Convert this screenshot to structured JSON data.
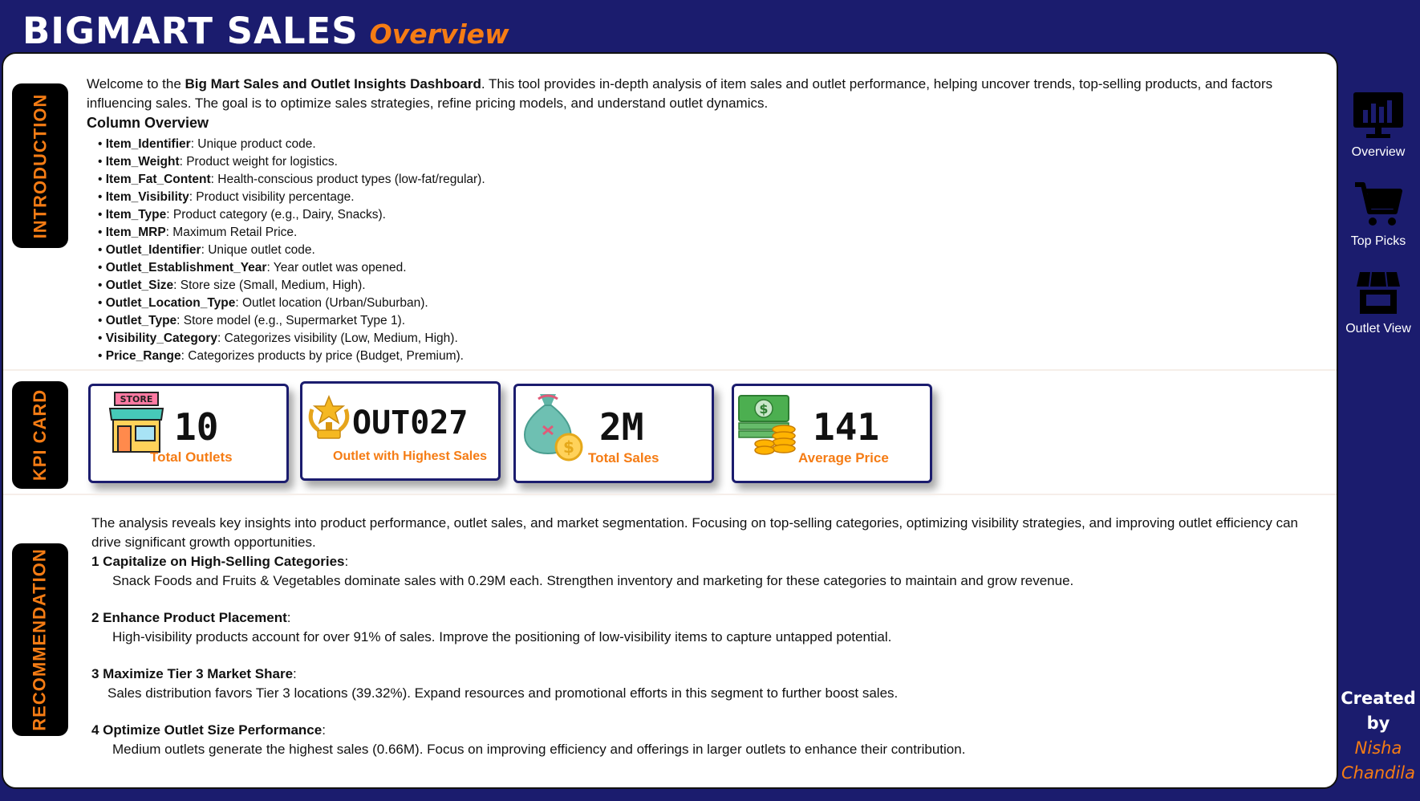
{
  "header": {
    "title": "BIGMART SALES",
    "subtitle": "Overview"
  },
  "sections": {
    "intro_tag": "INTRODUCTION",
    "kpi_tag": "KPI CARD",
    "rec_tag": "RECOMMENDATION"
  },
  "intro": {
    "welcome_pre": "Welcome to the ",
    "welcome_bold": "Big Mart Sales and Outlet Insights Dashboard",
    "welcome_post": ". This tool provides in-depth analysis of item sales and outlet performance, helping uncover trends, top-selling products, and factors influencing sales. The goal is to optimize sales strategies, refine pricing models, and understand outlet dynamics.",
    "column_heading": "Column Overview",
    "columns": [
      {
        "name": "Item_Identifier",
        "desc": ": Unique product code."
      },
      {
        "name": "Item_Weight",
        "desc": ": Product weight for logistics."
      },
      {
        "name": "Item_Fat_Content",
        "desc": ": Health-conscious product types (low-fat/regular)."
      },
      {
        "name": "Item_Visibility",
        "desc": ": Product visibility percentage."
      },
      {
        "name": "Item_Type",
        "desc": ": Product category (e.g., Dairy, Snacks)."
      },
      {
        "name": "Item_MRP",
        "desc": ": Maximum Retail Price."
      },
      {
        "name": "Outlet_Identifier",
        "desc": ": Unique outlet code."
      },
      {
        "name": "Outlet_Establishment_Year",
        "desc": ": Year outlet was opened."
      },
      {
        "name": "Outlet_Size",
        "desc": ": Store size (Small, Medium, High)."
      },
      {
        "name": "Outlet_Location_Type",
        "desc": ": Outlet location (Urban/Suburban)."
      },
      {
        "name": "Outlet_Type",
        "desc": ": Store model (e.g., Supermarket Type 1)."
      },
      {
        "name": "Visibility_Category",
        "desc": ": Categorizes visibility (Low, Medium, High)."
      },
      {
        "name": "Price_Range",
        "desc": ": Categorizes products by price (Budget, Premium)."
      }
    ]
  },
  "kpis": [
    {
      "value": "10",
      "label": "Total Outlets",
      "icon": "store-icon"
    },
    {
      "value": "OUT027",
      "label": "Outlet with Highest Sales",
      "icon": "trophy-icon"
    },
    {
      "value": "2M",
      "label": "Total Sales",
      "icon": "money-bag-icon"
    },
    {
      "value": "141",
      "label": "Average Price",
      "icon": "cash-coins-icon"
    }
  ],
  "recommendation": {
    "intro": "The analysis reveals key insights into product performance, outlet sales, and market segmentation. Focusing on top-selling categories, optimizing visibility strategies, and improving outlet efficiency can drive significant growth opportunities.",
    "items": [
      {
        "title": "1 Capitalize on High-Selling Categories",
        "suffix": ":",
        "body": "Snack Foods and Fruits & Vegetables dominate sales with 0.29M each. Strengthen inventory and marketing for these categories to maintain and grow revenue."
      },
      {
        "title": "2 Enhance Product Placement",
        "suffix": ":",
        "body": "High-visibility products account for over 91% of sales. Improve the positioning of low-visibility items to capture untapped potential."
      },
      {
        "title": "3 Maximize Tier 3 Market Share",
        "suffix": ":",
        "body": "Sales distribution favors Tier 3 locations (39.32%). Expand resources and promotional efforts in this segment to further boost sales."
      },
      {
        "title": "4 Optimize Outlet Size Performance",
        "suffix": ":",
        "body": "Medium outlets generate the highest sales (0.66M). Focus on improving efficiency and offerings in larger outlets to enhance their contribution."
      }
    ]
  },
  "nav": [
    {
      "label": "Overview",
      "icon": "chart-monitor-icon"
    },
    {
      "label": "Top Picks",
      "icon": "cart-icon"
    },
    {
      "label": "Outlet View",
      "icon": "storefront-icon"
    }
  ],
  "credit": {
    "line1": "Created",
    "line2": "by",
    "name1": "Nisha",
    "name2": "Chandila"
  },
  "colors": {
    "background": "#1b1c6e",
    "accent": "#f57c14",
    "panel": "#ffffff"
  }
}
